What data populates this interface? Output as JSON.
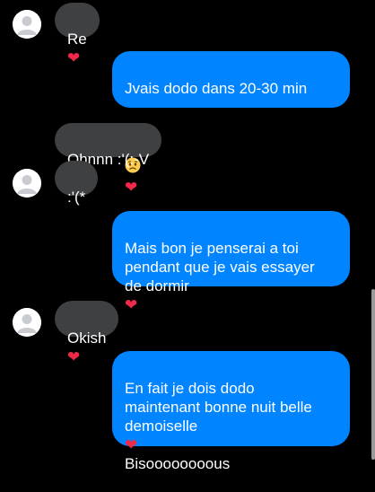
{
  "messages": [
    {
      "direction": "incoming",
      "text": "Re",
      "emoji": [
        "red-heart"
      ]
    },
    {
      "direction": "outgoing",
      "text": "Jvais dodo dans 20-30 min",
      "emoji": [
        "disappointed-face",
        "red-heart"
      ]
    },
    {
      "direction": "incoming",
      "text": "Ohnnn :'(:-V",
      "emoji": []
    },
    {
      "direction": "incoming",
      "text": ":'(*",
      "emoji": []
    },
    {
      "direction": "outgoing",
      "text": "Mais bon je penserai a toi\npendant que je vais essayer\nde dormir",
      "emoji": [
        "red-heart"
      ]
    },
    {
      "direction": "incoming",
      "text": "Okish",
      "emoji": [
        "red-heart"
      ]
    },
    {
      "direction": "outgoing",
      "text": "En fait je dois dodo\nmaintenant bonne nuit belle\ndemoiselle",
      "emoji": [
        "red-heart"
      ],
      "text_after": "Bisoooooooous"
    }
  ],
  "heart_glyph": "❤",
  "colors": {
    "background": "#000000",
    "incoming_bubble": "#3e4042",
    "outgoing_bubble": "#0084ff",
    "heart": "#f02849",
    "text": "#ffffff"
  }
}
